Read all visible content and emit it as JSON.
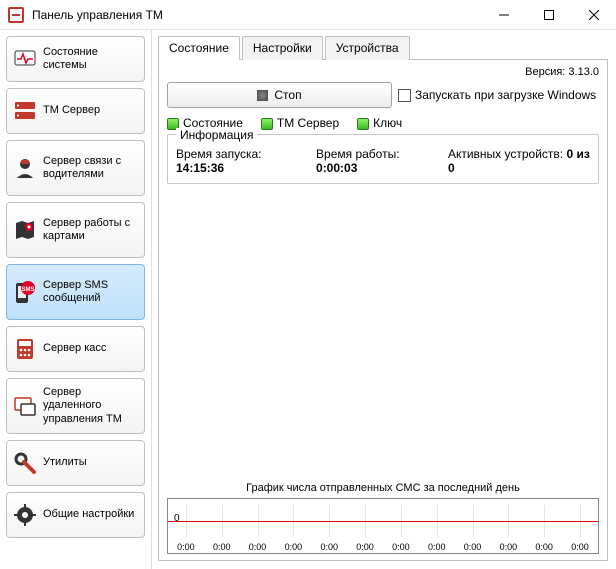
{
  "window": {
    "title": "Панель управления ТМ"
  },
  "sidebar": {
    "items": [
      {
        "label": "Состояние системы"
      },
      {
        "label": "ТМ Сервер"
      },
      {
        "label": "Сервер связи с водителями"
      },
      {
        "label": "Сервер работы с картами"
      },
      {
        "label": "Сервер SMS сообщений"
      },
      {
        "label": "Сервер касс"
      },
      {
        "label": "Сервер удаленного управления ТМ"
      },
      {
        "label": "Утилиты"
      },
      {
        "label": "Общие настройки"
      }
    ]
  },
  "tabs": [
    {
      "label": "Состояние",
      "active": true
    },
    {
      "label": "Настройки",
      "active": false
    },
    {
      "label": "Устройства",
      "active": false
    }
  ],
  "version_label": "Версия: 3.13.0",
  "controls": {
    "stop_label": "Стоп",
    "autostart_label": "Запускать при загрузке Windows",
    "autostart_checked": false
  },
  "status": {
    "items": [
      {
        "label": "Состояние"
      },
      {
        "label": "ТМ Сервер"
      },
      {
        "label": "Ключ"
      }
    ]
  },
  "info": {
    "legend": "Информация",
    "start_label": "Время запуска:",
    "start_value": "14:15:36",
    "uptime_label": "Время работы:",
    "uptime_value": "0:00:03",
    "devices_label": "Активных устройств:",
    "devices_value": "0 из 0"
  },
  "chart_data": {
    "type": "line",
    "title": "График числа отправленных СМС за последний день",
    "xlabel": "",
    "ylabel": "",
    "ylim": [
      0,
      1
    ],
    "x_ticks": [
      "0:00",
      "0:00",
      "0:00",
      "0:00",
      "0:00",
      "0:00",
      "0:00",
      "0:00",
      "0:00",
      "0:00",
      "0:00",
      "0:00"
    ],
    "series": [
      {
        "name": "sms",
        "values": [
          0,
          0,
          0,
          0,
          0,
          0,
          0,
          0,
          0,
          0,
          0,
          0
        ]
      }
    ]
  }
}
